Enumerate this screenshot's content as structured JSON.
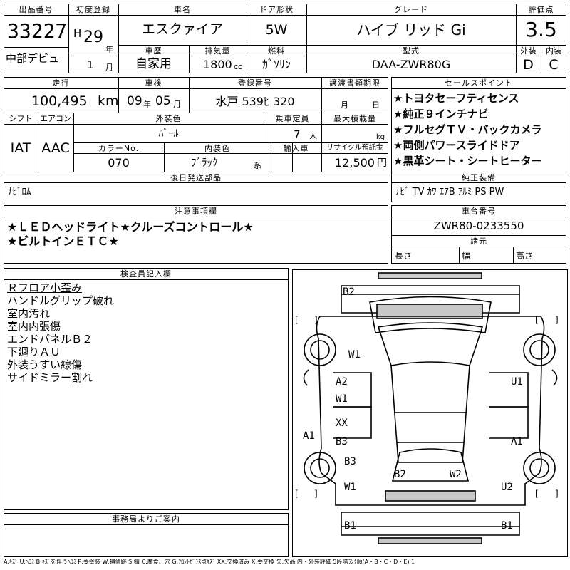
{
  "header": {
    "lot_no_label": "出品番号",
    "lot_no": "33227",
    "first_reg_label": "初度登録",
    "era": "H",
    "first_reg_year": "29",
    "year_unit": "年",
    "first_reg_month": "1",
    "month_unit": "月",
    "car_name_label": "車名",
    "car_name": "エスクァイア",
    "door_label": "ドア形状",
    "door": "5W",
    "grade_label": "グレード",
    "grade": "ハイブ リッド Gi",
    "score_label": "評価点",
    "score": "3.5",
    "debut": "中部デビュ",
    "history_label": "車歴",
    "history": "自家用",
    "displacement_label": "排気量",
    "displacement": "1800",
    "cc_unit": "cc",
    "fuel_label": "燃料",
    "fuel": "ｶﾞｿﾘﾝ",
    "model_label": "型式",
    "model": "DAA-ZWR80G",
    "exterior_label": "外装",
    "exterior_grade": "D",
    "interior_label": "内装",
    "interior_grade": "C"
  },
  "row2": {
    "mileage_label": "走行",
    "mileage": "100,495",
    "mileage_unit": "km",
    "inspection_label": "車検",
    "inspection_year": "09",
    "inspection_year_unit": "年",
    "inspection_month": "05",
    "inspection_month_unit": "月",
    "plate_label": "登録番号",
    "plate": "水戸 539ﾋ 320",
    "transfer_label": "譲渡書類期限",
    "transfer_month_unit": "月",
    "transfer_day_unit": "日",
    "shift_label": "シフト",
    "shift": "IAT",
    "ac_label": "エアコン",
    "ac": "AAC",
    "exterior_color_label": "外装色",
    "exterior_color": "ﾊﾟｰﾙ",
    "capacity_label": "乗車定員",
    "capacity": "7",
    "capacity_unit": "人",
    "max_load_label": "最大積載量",
    "max_load_unit": "kg",
    "color_no_label": "カラーNo.",
    "color_no": "070",
    "interior_color_label": "内装色",
    "interior_color": "ﾌﾞﾗｯｸ",
    "interior_color_unit": "系",
    "import_label": "輸入車",
    "recycle_label": "リサイクル預託金",
    "recycle": "12,500",
    "recycle_unit": "円",
    "later_parts_label": "後日発送部品",
    "later_parts": "ﾅﾋﾞﾛﾑ"
  },
  "sales_points": {
    "label": "セールスポイント",
    "items": [
      "★トヨタセーフティセンス",
      "★純正９インチナビ",
      "★フルセグＴＶ・バックカメラ",
      "★両側パワースライドドア",
      "★黒革シート・シートヒーター"
    ]
  },
  "equipment": {
    "label": "純正装備",
    "value": "ﾅﾋﾞ TV ｶﾜ ｴｱB ｱﾙﾐ PS PW"
  },
  "notes": {
    "label": "注意事項欄",
    "line1": "★ＬＥＤヘッドライト★クルーズコントロール★",
    "line2": "★ビルトインＥＴＣ★"
  },
  "chassis": {
    "label": "車台番号",
    "value": "ZWR80-0233550",
    "dims_label": "諸元",
    "length_label": "長さ",
    "width_label": "幅",
    "height_label": "高さ"
  },
  "inspector": {
    "label": "検査員記入欄",
    "items": [
      "Ｒフロア小歪み",
      "ハンドルグリップ破れ",
      "室内汚れ",
      "室内内張傷",
      "エンドパネルＢ２",
      "下廻りＡＵ",
      "外装うすい線傷",
      "サイドミラー割れ"
    ]
  },
  "office": {
    "label": "事務局よりご案内"
  },
  "diagram_marks": [
    "B2",
    "W1",
    "A2",
    "W1",
    "XX",
    "B3",
    "B3",
    "W1",
    "A1",
    "U1",
    "A1",
    "B2",
    "W2",
    "U2",
    "B1",
    "B1"
  ],
  "legend": "A:ｷｽﾞ U:ﾍｺﾐ B:ｷｽﾞを伴うﾍｺﾐ P:要塗装 W:補修跡 S:錆 C:腐食、穴 G:ﾌﾛﾝﾄｶﾞﾗｽ点ｷｽﾞ XX:交換済み X:要交換 欠:欠品 内・外装評価 5段階ﾗﾝｸ順(A・B・C・D・E) 1"
}
